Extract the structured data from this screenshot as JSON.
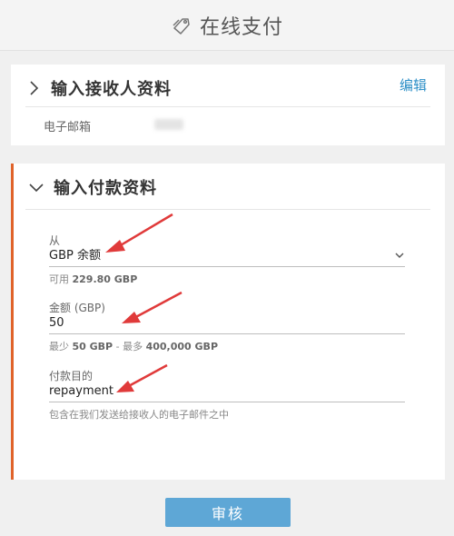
{
  "header": {
    "title": "在线支付",
    "icon": "payment-tag-icon"
  },
  "recipient": {
    "title": "输入接收人资料",
    "edit_label": "编辑",
    "email_label": "电子邮箱",
    "email_value_redacted": true
  },
  "payment": {
    "title": "输入付款资料",
    "accent_color": "#e0632a",
    "from": {
      "label": "从",
      "value": "GBP 余额",
      "available_prefix": "可用",
      "available_amount": "229.80 GBP"
    },
    "amount": {
      "label": "金额 (GBP)",
      "value": "50",
      "min_prefix": "最少",
      "min_value": "50 GBP",
      "separator": " - ",
      "max_prefix": "最多",
      "max_value": "400,000 GBP"
    },
    "purpose": {
      "label": "付款目的",
      "value": "repayment",
      "hint": "包含在我们发送给接收人的电子邮件之中"
    }
  },
  "footer": {
    "review_label": "审核",
    "button_color": "#5ea7d6"
  },
  "annotations": {
    "arrow_color": "#e03a3a",
    "arrow_count": 3
  }
}
